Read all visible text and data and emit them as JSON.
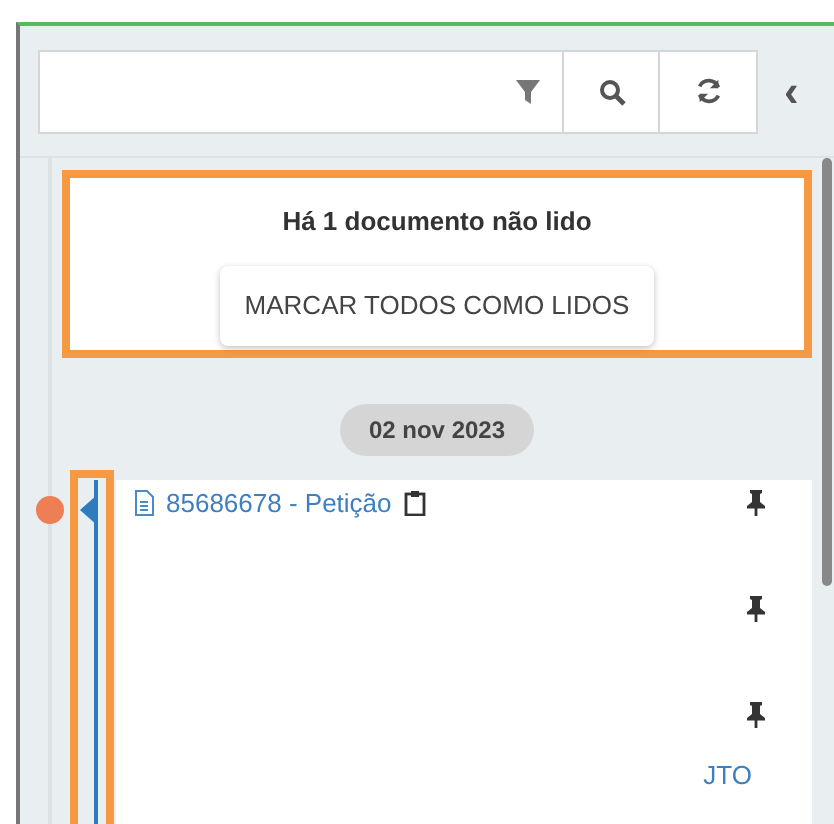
{
  "toolbar": {
    "collapse_glyph": "‹"
  },
  "notice": {
    "text": "Há 1 documento não lido",
    "button": "MARCAR TODOS COMO LIDOS"
  },
  "date_badge": "02 nov 2023",
  "documents": [
    {
      "title": "85686678 - Petição",
      "unread": true,
      "has_clipboard": true
    },
    {
      "unread": false
    },
    {
      "title": "JTO",
      "unread": false
    }
  ]
}
